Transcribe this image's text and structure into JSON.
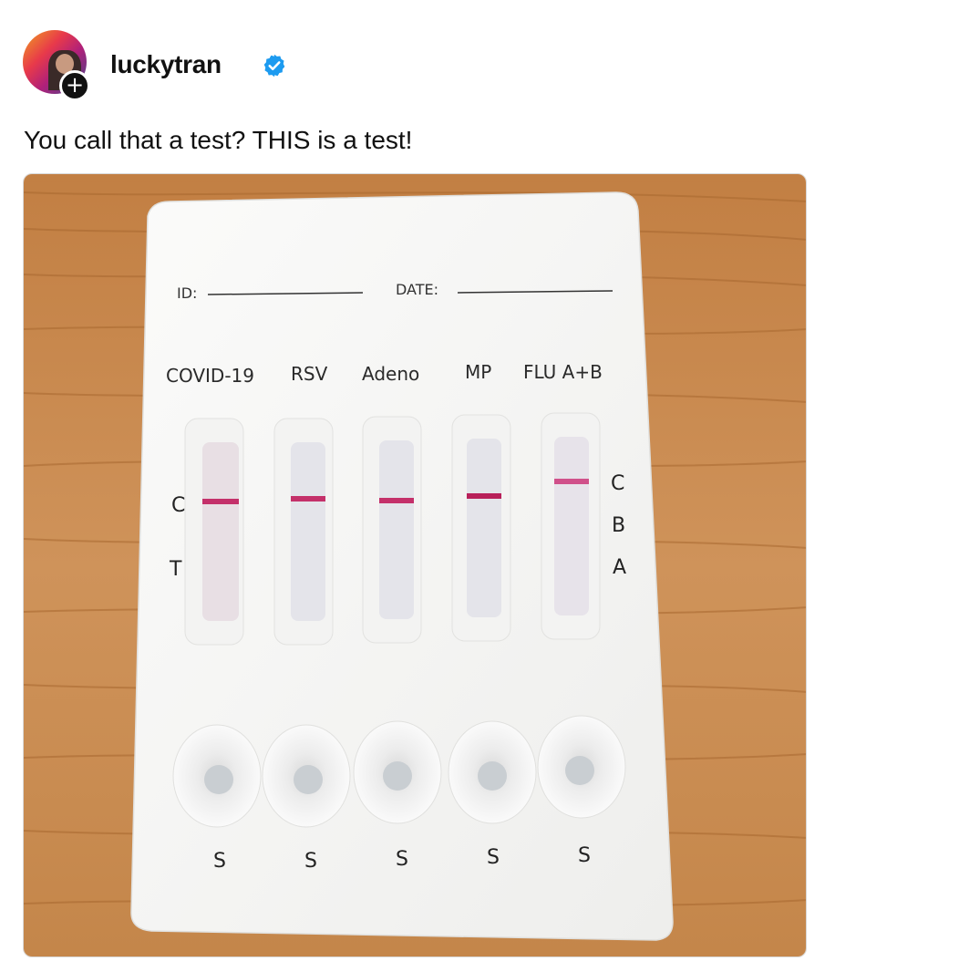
{
  "post": {
    "username": "luckytran",
    "verified": true,
    "caption": "You call that a test? THIS is a test!",
    "follow_icon": "plus-icon"
  },
  "test_card": {
    "id_label": "ID:",
    "date_label": "DATE:",
    "tests": [
      "COVID-19",
      "RSV",
      "Adeno",
      "MP",
      "FLU A+B"
    ],
    "left_markers": [
      "C",
      "T"
    ],
    "right_markers": [
      "C",
      "B",
      "A"
    ],
    "sample_label": "S"
  },
  "colors": {
    "verified_blue": "#1d9bf0",
    "control_line": "#c4306a",
    "card": "#f7f7f5",
    "wood": "#c98a4c"
  }
}
